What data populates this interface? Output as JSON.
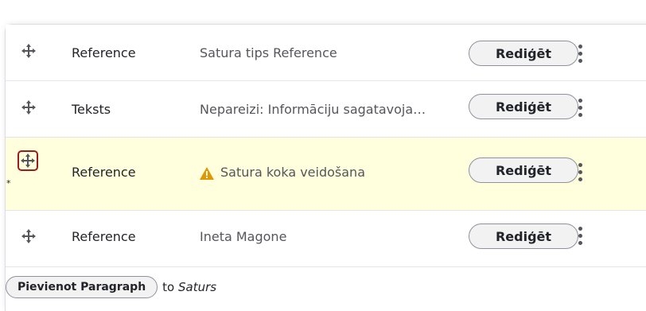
{
  "rows": [
    {
      "type": "Reference",
      "summary": "Satura tips Reference",
      "edit_label": "Rediģēt",
      "warning": false,
      "highlighted": false,
      "focused_handle": false
    },
    {
      "type": "Teksts",
      "summary": "Nepareizi: Informāciju sagatavoja…",
      "edit_label": "Rediģēt",
      "warning": false,
      "highlighted": false,
      "focused_handle": false
    },
    {
      "type": "Reference",
      "summary": "Satura koka veidošana",
      "edit_label": "Rediģēt",
      "warning": true,
      "highlighted": true,
      "focused_handle": true
    },
    {
      "type": "Reference",
      "summary": "Ineta Magone",
      "edit_label": "Rediģēt",
      "warning": false,
      "highlighted": false,
      "focused_handle": false
    }
  ],
  "changed_marker": "*",
  "footer": {
    "add_label": "Pievienot Paragraph",
    "to_prefix": "to",
    "to_target": "Saturs"
  },
  "colors": {
    "highlight": "#ffffdd",
    "focus_border": "#9b1c1c",
    "warning": "#e29700"
  }
}
